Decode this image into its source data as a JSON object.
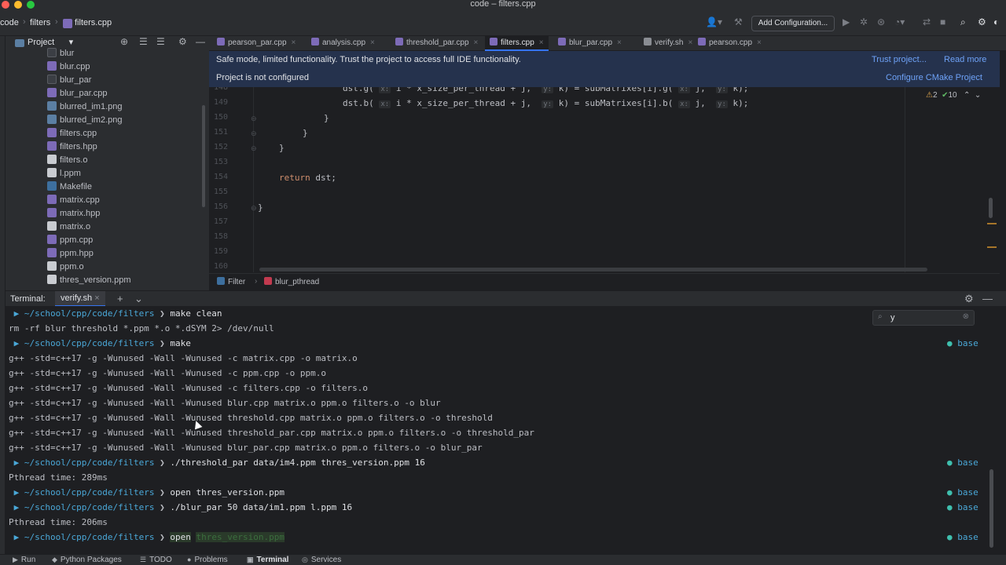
{
  "window": {
    "title": "code – filters.cpp"
  },
  "breadcrumb": [
    "code",
    "filters",
    "filters.cpp"
  ],
  "toolbar": {
    "add_configuration": "Add Configuration..."
  },
  "project_panel": {
    "title": "Project",
    "files": [
      {
        "name": "blur",
        "type": "bin"
      },
      {
        "name": "blur.cpp",
        "type": "cpp"
      },
      {
        "name": "blur_par",
        "type": "bin"
      },
      {
        "name": "blur_par.cpp",
        "type": "cpp"
      },
      {
        "name": "blurred_im1.png",
        "type": "img"
      },
      {
        "name": "blurred_im2.png",
        "type": "img"
      },
      {
        "name": "filters.cpp",
        "type": "cpp"
      },
      {
        "name": "filters.hpp",
        "type": "hpp"
      },
      {
        "name": "filters.o",
        "type": "file"
      },
      {
        "name": "l.ppm",
        "type": "file"
      },
      {
        "name": "Makefile",
        "type": "make"
      },
      {
        "name": "matrix.cpp",
        "type": "cpp"
      },
      {
        "name": "matrix.hpp",
        "type": "hpp"
      },
      {
        "name": "matrix.o",
        "type": "file"
      },
      {
        "name": "ppm.cpp",
        "type": "cpp"
      },
      {
        "name": "ppm.hpp",
        "type": "hpp"
      },
      {
        "name": "ppm.o",
        "type": "file"
      },
      {
        "name": "thres_version.ppm",
        "type": "file"
      }
    ]
  },
  "tabs": [
    {
      "label": "pearson_par.cpp",
      "kind": "cpp",
      "active": false
    },
    {
      "label": "analysis.cpp",
      "kind": "cpp",
      "active": false
    },
    {
      "label": "threshold_par.cpp",
      "kind": "cpp",
      "active": false
    },
    {
      "label": "filters.cpp",
      "kind": "cpp",
      "active": true
    },
    {
      "label": "blur_par.cpp",
      "kind": "cpp",
      "active": false
    },
    {
      "label": "verify.sh",
      "kind": "sh",
      "active": false
    },
    {
      "label": "pearson.cpp",
      "kind": "cpp",
      "active": false
    }
  ],
  "banners": {
    "safe_mode": {
      "text": "Safe mode, limited functionality. Trust the project to access full IDE functionality.",
      "link1": "Trust project...",
      "link2": "Read more"
    },
    "cmake": {
      "text": "Project is not configured",
      "link": "Configure CMake Project"
    }
  },
  "editor": {
    "inspections": {
      "warnings": "2",
      "ok": "10"
    },
    "lines": [
      {
        "n": "148",
        "code": "dst.g( x: i * x_size_per_thread + j,  y: k) = subMatrixes[i].g( x: j,  y: k);"
      },
      {
        "n": "149",
        "code": "dst.b( x: i * x_size_per_thread + j,  y: k) = subMatrixes[i].b( x: j,  y: k);"
      },
      {
        "n": "150",
        "code": "}"
      },
      {
        "n": "151",
        "code": "}"
      },
      {
        "n": "152",
        "code": "}"
      },
      {
        "n": "153",
        "code": ""
      },
      {
        "n": "154",
        "code": "return dst;"
      },
      {
        "n": "155",
        "code": ""
      },
      {
        "n": "156",
        "code": "}"
      },
      {
        "n": "157",
        "code": ""
      },
      {
        "n": "158",
        "code": ""
      },
      {
        "n": "159",
        "code": ""
      },
      {
        "n": "160",
        "code": ""
      }
    ],
    "structure": [
      "Filter",
      "blur_pthread"
    ]
  },
  "terminal": {
    "label": "Terminal:",
    "tab": "verify.sh",
    "search_value": "y",
    "prompt_path": "~/school/cpp/code/filters",
    "env_tag": "base",
    "lines": [
      {
        "kind": "prompt",
        "cmd": "make clean",
        "base": false
      },
      {
        "kind": "out",
        "text": "rm -rf blur threshold *.ppm *.o *.dSYM 2> /dev/null"
      },
      {
        "kind": "prompt",
        "cmd": "make",
        "base": true
      },
      {
        "kind": "out",
        "text": "g++ -std=c++17 -g -Wunused -Wall -Wunused -c matrix.cpp -o matrix.o"
      },
      {
        "kind": "out",
        "text": "g++ -std=c++17 -g -Wunused -Wall -Wunused -c ppm.cpp -o ppm.o"
      },
      {
        "kind": "out",
        "text": "g++ -std=c++17 -g -Wunused -Wall -Wunused -c filters.cpp -o filters.o"
      },
      {
        "kind": "out",
        "text": "g++ -std=c++17 -g -Wunused -Wall -Wunused blur.cpp matrix.o ppm.o filters.o -o blur"
      },
      {
        "kind": "out",
        "text": "g++ -std=c++17 -g -Wunused -Wall -Wunused threshold.cpp matrix.o ppm.o filters.o -o threshold"
      },
      {
        "kind": "out",
        "text": "g++ -std=c++17 -g -Wunused -Wall -Wunused threshold_par.cpp matrix.o ppm.o filters.o -o threshold_par"
      },
      {
        "kind": "out",
        "text": "g++ -std=c++17 -g -Wunused -Wall -Wunused blur_par.cpp matrix.o ppm.o filters.o -o blur_par"
      },
      {
        "kind": "prompt",
        "cmd": "./threshold_par data/im4.ppm thres_version.ppm 16",
        "base": true
      },
      {
        "kind": "out",
        "text": "Pthread time: 289ms"
      },
      {
        "kind": "prompt",
        "cmd": "open thres_version.ppm",
        "base": true
      },
      {
        "kind": "prompt",
        "cmd": "./blur_par 50 data/im1.ppm l.ppm 16",
        "base": true
      },
      {
        "kind": "out",
        "text": "Pthread time: 206ms"
      },
      {
        "kind": "prompt",
        "cmd": "open",
        "base": true,
        "ghost": "thres_version.ppm"
      }
    ]
  },
  "bottombar": [
    {
      "label": "Run",
      "icon": "▶",
      "active": false
    },
    {
      "label": "Python Packages",
      "icon": "◆",
      "active": false
    },
    {
      "label": "TODO",
      "icon": "☰",
      "active": false
    },
    {
      "label": "Problems",
      "icon": "●",
      "active": false
    },
    {
      "label": "Terminal",
      "icon": "▣",
      "active": true
    },
    {
      "label": "Services",
      "icon": "◎",
      "active": false
    }
  ],
  "colors": {
    "accent": "#3574f0",
    "banner_bg": "#25324d",
    "link": "#6ea2f7",
    "prompt": "#4aa8d8",
    "keyword": "#cf8e6d",
    "cpp_icon": "#7d6bb8"
  }
}
